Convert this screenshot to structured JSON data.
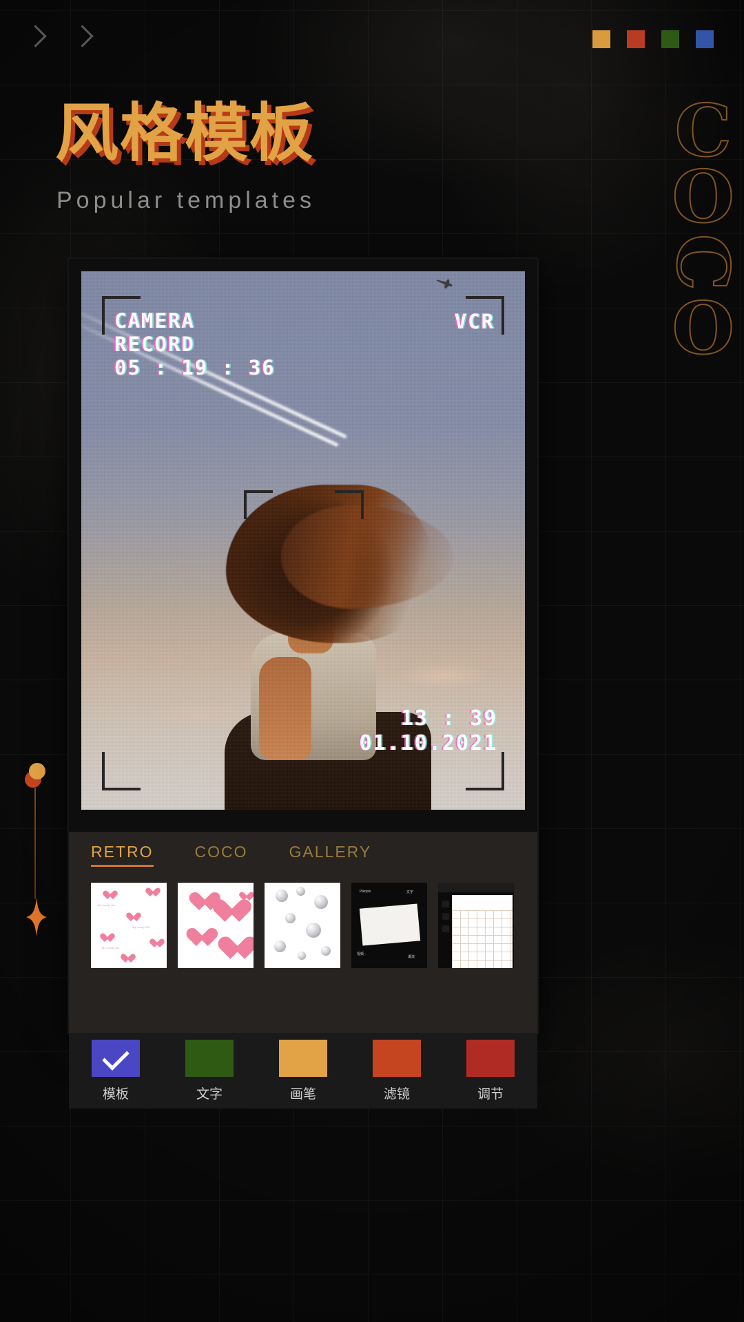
{
  "header": {
    "nav_chevrons": [
      "chevron-right",
      "chevron-right"
    ],
    "swatches": [
      {
        "name": "swatch-amber",
        "color": "#D99B3F"
      },
      {
        "name": "swatch-red",
        "color": "#B83C22"
      },
      {
        "name": "swatch-green",
        "color": "#2F5A14"
      },
      {
        "name": "swatch-blue",
        "color": "#3355A8"
      }
    ],
    "title": "风格模板",
    "subtitle": "Popular templates",
    "brand_vertical": [
      "C",
      "O",
      "C",
      "O"
    ]
  },
  "preview": {
    "overlay_label_line1": "CAMERA",
    "overlay_label_line2": "RECORD",
    "overlay_timecode": "05 : 19 : 36",
    "overlay_mode": "VCR",
    "stamp_time": "13 : 39",
    "stamp_date": "01.10.2021"
  },
  "tabs": [
    {
      "label": "RETRO",
      "active": true
    },
    {
      "label": "COCO",
      "active": false
    },
    {
      "label": "GALLERY",
      "active": false
    }
  ],
  "thumbnails": [
    {
      "name": "template-hearts-small",
      "style": "hearts-small",
      "caption": "My Lovely Girl"
    },
    {
      "name": "template-hearts-large",
      "style": "hearts-large"
    },
    {
      "name": "template-pearls",
      "style": "pearls"
    },
    {
      "name": "template-polaroid-dark",
      "style": "polaroid-dark",
      "label_top": "Pikoplo",
      "label_cn_top": "文字",
      "label_cn_left": "视频",
      "label_cn_right": "潮流"
    },
    {
      "name": "template-phone-ui",
      "style": "phone-ui"
    }
  ],
  "toolbar": [
    {
      "label": "模板",
      "color": "#4B46C4",
      "selected": true,
      "icon": "check-icon"
    },
    {
      "label": "文字",
      "color": "#2F5A14",
      "selected": false
    },
    {
      "label": "画笔",
      "color": "#E2A246",
      "selected": false
    },
    {
      "label": "滤镜",
      "color": "#C4451F",
      "selected": false
    },
    {
      "label": "调节",
      "color": "#B02B24",
      "selected": false
    }
  ],
  "decor": {
    "dot_color_a": "#E2A246",
    "dot_color_b": "#C4451F",
    "sparkle": "sparkle-icon"
  }
}
